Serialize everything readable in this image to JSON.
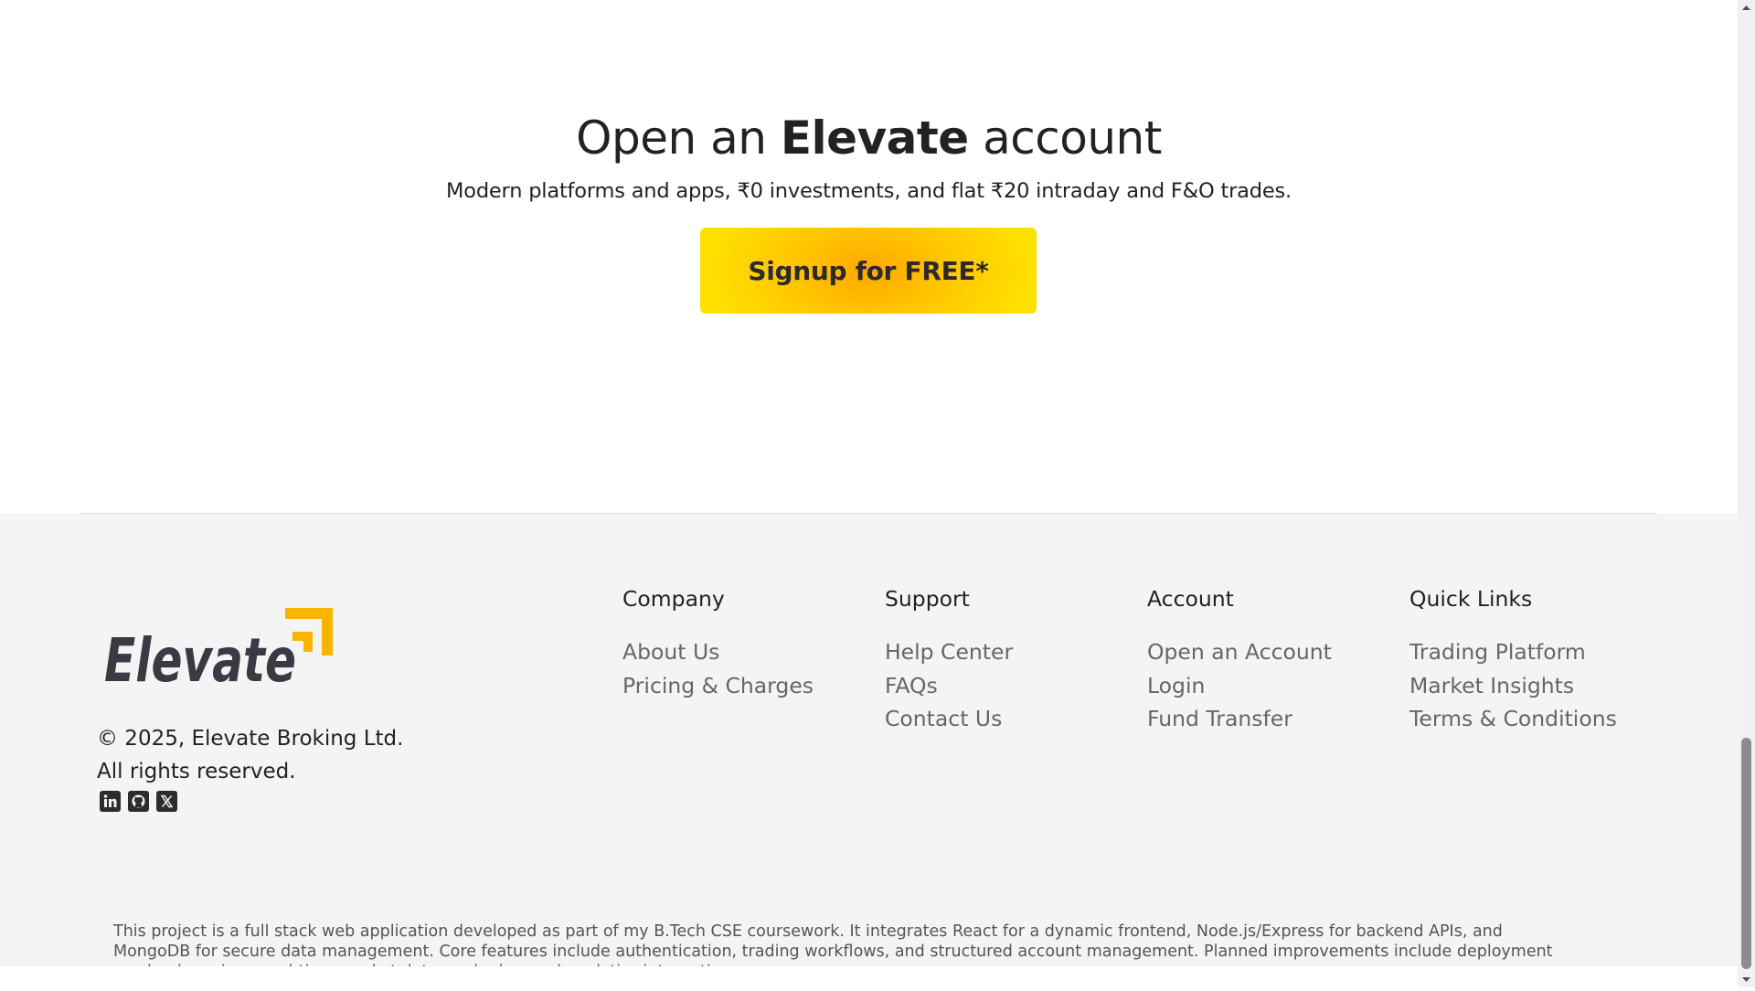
{
  "cta": {
    "title_prefix": "Open an",
    "title_brand": "Elevate",
    "title_suffix": "account",
    "subtitle": "Modern platforms and apps, ₹0 investments, and flat ₹20 intraday and F&O trades.",
    "button_label": "Signup for FREE*"
  },
  "footer": {
    "logo_text": "Elevate",
    "copyright_line1": "© 2025, Elevate Broking Ltd.",
    "copyright_line2": "All rights reserved.",
    "socials": [
      "linkedin-icon",
      "github-icon",
      "x-icon"
    ],
    "columns": [
      {
        "heading": "Company",
        "links": [
          "About Us",
          "Pricing & Charges"
        ]
      },
      {
        "heading": "Support",
        "links": [
          "Help Center",
          "FAQs",
          "Contact Us"
        ]
      },
      {
        "heading": "Account",
        "links": [
          "Open an Account",
          "Login",
          "Fund Transfer"
        ]
      },
      {
        "heading": "Quick Links",
        "links": [
          "Trading Platform",
          "Market Insights",
          "Terms & Conditions"
        ]
      }
    ],
    "disclaimer": "This project is a full stack web application developed as part of my B.Tech CSE coursework. It integrates React for a dynamic frontend, Node.js/Express for backend APIs, and MongoDB for secure data management. Core features include authentication, trading workflows, and structured account management. Planned improvements include deployment on cloud services, real-time market data, and advanced analytics integration."
  },
  "colors": {
    "button_yellow": "#ffe000",
    "button_orange": "#ffa800",
    "logo_dark": "#3a3a44",
    "logo_accent": "#f7b500",
    "footer_bg": "#f4f4f4"
  }
}
